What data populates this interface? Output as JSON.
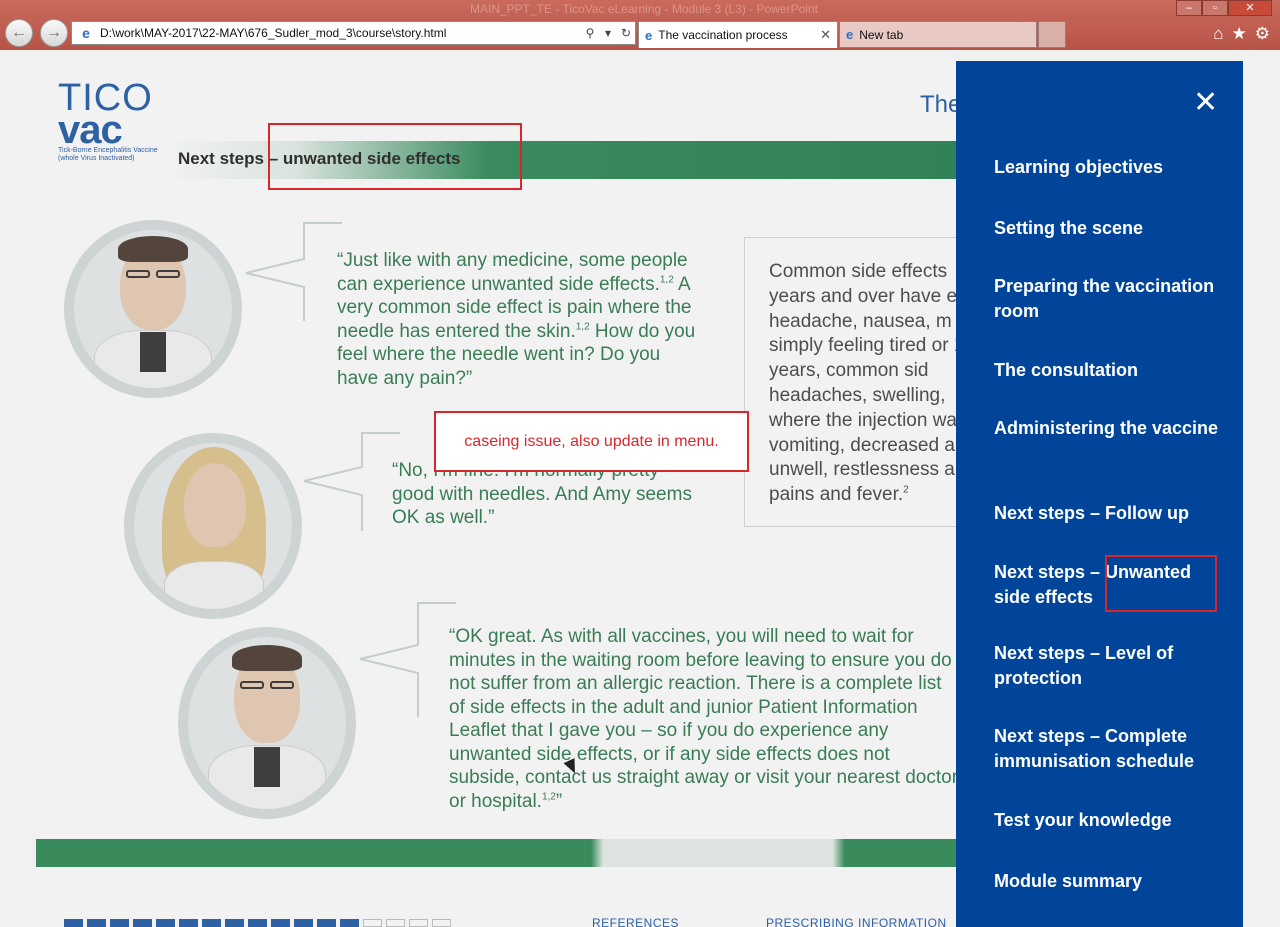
{
  "browser": {
    "title_ghost": "MAIN_PPT_TE - TicoVac eLearning - Module 3 (L3) - PowerPoint",
    "address": "D:\\work\\MAY-2017\\22-MAY\\676_Sudler_mod_3\\course\\story.html",
    "tabs": [
      "The vaccination process",
      "New tab"
    ],
    "win_controls": [
      "–",
      "▫",
      "✕"
    ]
  },
  "slide": {
    "logo_top": "TICO",
    "logo_main": "vac",
    "logo_sub": "Tick-Borne Encephalitis Vaccine (whole Virus Inactivated)",
    "title": "Next steps – unwanted side effects",
    "heading_partial": "The",
    "quote1_parts": [
      "“Just like with any medicine, some people can experience unwanted side effects.",
      "1,2",
      " A very common side effect is pain where the needle has entered the skin.",
      "1,2",
      " How do you feel where the needle went in? Do you have any pain?”"
    ],
    "quote2": "“No, I'm fine. I'm normally pretty good with needles. And Amy seems OK as well.”",
    "quote3_parts": [
      "“OK great. As with all vaccines, you will need to wait for minutes in the waiting room before leaving to ensure you do not suffer from an allergic reaction. There is a complete list of side effects in the adult and junior Patient Information Leaflet that I gave you – so if you do experience any unwanted side effects, or if any side effects does not subside, contact us straight away or visit your nearest doctor or hospital.",
      "1,2",
      "”"
    ],
    "sidebox_parts": [
      "Common side effects years and over have e headache, nausea, m simply feeling tired or 16 years, common sid headaches, swelling, where the injection wa vomiting, decreased a unwell, restlessness a pains and fever.",
      "2"
    ],
    "footer_links": [
      "REFERENCES",
      "PRESCRIBING INFORMATION"
    ],
    "progress": {
      "completed": 13,
      "total": 17
    }
  },
  "annotation": {
    "comment": "caseing issue, also update in menu."
  },
  "menu": {
    "close": "✕",
    "items": [
      "Learning objectives",
      "Setting the scene",
      "Preparing the vaccination room",
      "The consultation",
      "Administering the vaccine",
      "Next steps – Follow up",
      "Next steps – Unwanted side effects",
      "Next steps – Level of protection",
      "Next steps – Complete immunisation schedule",
      "Test your knowledge",
      "Module summary"
    ]
  },
  "colors": {
    "menu_bg": "#00459a",
    "green": "#2e7a4d",
    "annotation_red": "#d8262b"
  }
}
